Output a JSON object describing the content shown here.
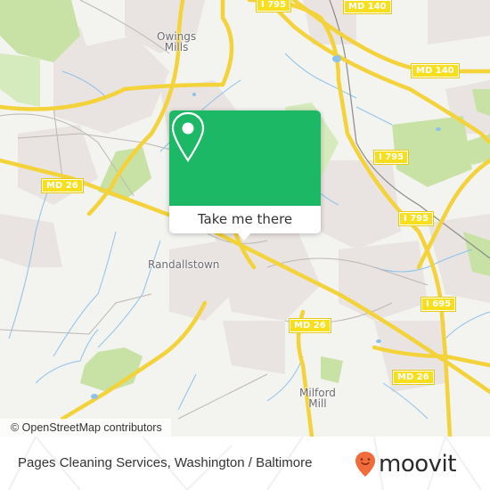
{
  "map": {
    "places": [
      {
        "name": "Owings Mills",
        "lines": [
          "Owings",
          "Mills"
        ]
      },
      {
        "name": "Randallstown",
        "lines": [
          "Randallstown"
        ]
      },
      {
        "name": "Milford Mill",
        "lines": [
          "Milford",
          "Mill"
        ]
      }
    ],
    "road_shields": [
      {
        "label": "I 795"
      },
      {
        "label": "MD 140"
      },
      {
        "label": "MD 140"
      },
      {
        "label": "MD 26"
      },
      {
        "label": "I 795"
      },
      {
        "label": "I 795"
      },
      {
        "label": "I 695"
      },
      {
        "label": "MD 26"
      },
      {
        "label": "MD 26"
      }
    ],
    "colors": {
      "land": "#f3f3f0",
      "residential": "#e9e4e2",
      "park": "#c8e2a6",
      "water": "#7fb8e8",
      "major_road": "#f7df5a",
      "minor_road": "#b8b2ae"
    }
  },
  "popup": {
    "icon": "map-pin-icon",
    "action_label": "Take me there",
    "accent_color": "#1db866"
  },
  "attribution": "© OpenStreetMap contributors",
  "footer": {
    "title": "Pages Cleaning Services, Washington / Baltimore",
    "brand": {
      "name": "moovit",
      "icon": "moovit-logo-icon",
      "color": "#f26b3a"
    }
  }
}
